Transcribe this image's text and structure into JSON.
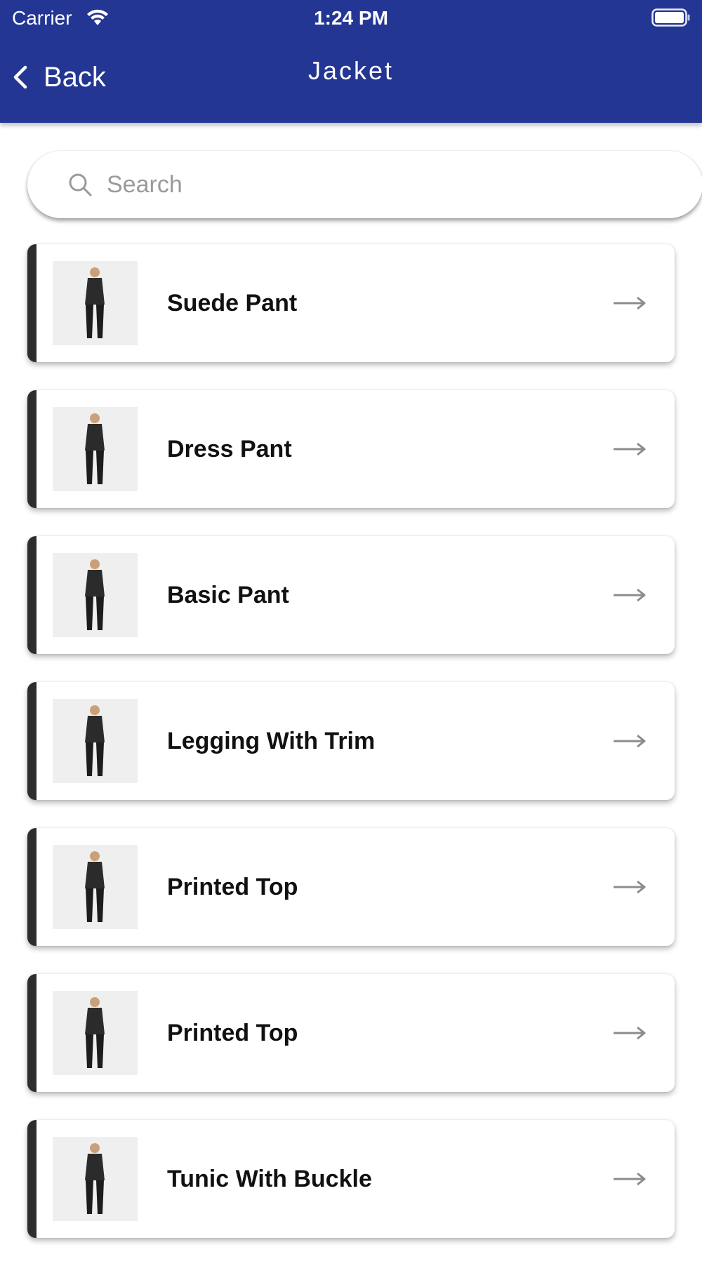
{
  "status_bar": {
    "carrier": "Carrier",
    "time": "1:24 PM"
  },
  "nav": {
    "back_label": "Back",
    "title": "Jacket"
  },
  "search": {
    "placeholder": "Search",
    "value": ""
  },
  "colors": {
    "header_bg": "#243693",
    "accent_bar": "#2d2d2d"
  },
  "products": [
    {
      "name": "Suede Pant",
      "icon": "product-thumbnail"
    },
    {
      "name": "Dress Pant",
      "icon": "product-thumbnail"
    },
    {
      "name": "Basic Pant",
      "icon": "product-thumbnail"
    },
    {
      "name": "Legging With Trim",
      "icon": "product-thumbnail"
    },
    {
      "name": "Printed Top",
      "icon": "product-thumbnail"
    },
    {
      "name": "Printed Top",
      "icon": "product-thumbnail"
    },
    {
      "name": "Tunic With Buckle",
      "icon": "product-thumbnail"
    }
  ]
}
